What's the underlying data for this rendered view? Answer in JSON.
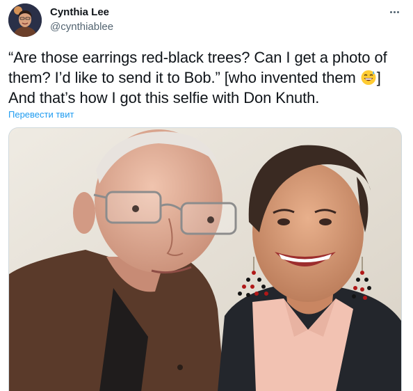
{
  "author": {
    "display_name": "Cynthia Lee",
    "handle": "@cynthiablee",
    "avatar_icon": "profile-avatar"
  },
  "tweet": {
    "text_before_emoji": "“Are those earrings red-black trees? Can I get a photo of them? I’d like to send it to Bob.” [who invented them ",
    "emoji": "grinning-face-with-sweat",
    "text_after_emoji": "] And that’s how I got this selfie with Don Knuth.",
    "translate_label": "Перевести твит"
  },
  "menu": {
    "more_icon": "more-horizontal-icon"
  },
  "media": {
    "kind": "photo",
    "description_icon": "selfie-photo"
  },
  "colors": {
    "text_primary": "#0f1419",
    "text_secondary": "#536471",
    "link": "#1d9bf0",
    "border": "#cfd9de"
  }
}
